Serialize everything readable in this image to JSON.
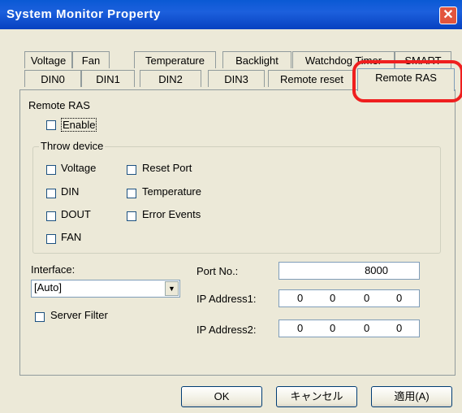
{
  "window": {
    "title": "System Monitor Property",
    "close_glyph": "✕"
  },
  "tabs_row1": [
    {
      "label": "Voltage"
    },
    {
      "label": "Fan"
    },
    {
      "label": "Temperature"
    },
    {
      "label": "Backlight"
    },
    {
      "label": "Watchdog Timer"
    },
    {
      "label": "SMART"
    }
  ],
  "tabs_row2": [
    {
      "label": "DIN0"
    },
    {
      "label": "DIN1"
    },
    {
      "label": "DIN2"
    },
    {
      "label": "DIN3"
    },
    {
      "label": "Remote reset"
    },
    {
      "label": "Remote RAS"
    }
  ],
  "active_tab": "Remote RAS",
  "remote_ras": {
    "section_label": "Remote RAS",
    "enable": {
      "label": "Enable",
      "checked": false
    },
    "throw_device": {
      "legend": "Throw device",
      "left": [
        {
          "label": "Voltage",
          "checked": false
        },
        {
          "label": "DIN",
          "checked": false
        },
        {
          "label": "DOUT",
          "checked": false
        },
        {
          "label": "FAN",
          "checked": false
        }
      ],
      "right": [
        {
          "label": "Reset Port",
          "checked": false
        },
        {
          "label": "Temperature",
          "checked": false
        },
        {
          "label": "Error Events",
          "checked": false
        }
      ]
    },
    "interface": {
      "label": "Interface:",
      "value": "[Auto]"
    },
    "server_filter": {
      "label": "Server Filter",
      "checked": false
    },
    "port": {
      "label": "Port No.:",
      "value": "8000"
    },
    "ip1": {
      "label": "IP Address1:",
      "octets": [
        "0",
        "0",
        "0",
        "0"
      ]
    },
    "ip2": {
      "label": "IP Address2:",
      "octets": [
        "0",
        "0",
        "0",
        "0"
      ]
    }
  },
  "buttons": {
    "ok": "OK",
    "cancel": "キャンセル",
    "apply": "適用(A)"
  },
  "colors": {
    "titlebar": "#0a59d4",
    "highlight": "#ef1f1f",
    "dialog_bg": "#ece9d8"
  }
}
